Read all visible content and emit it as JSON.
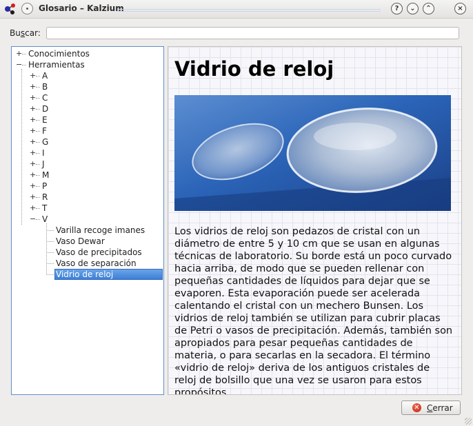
{
  "window": {
    "title": "Glosario – Kalzium",
    "buttons": {
      "help": "?",
      "minimize": "⌄",
      "maximize": "⌃",
      "close": "×"
    }
  },
  "search": {
    "label_pre": "Bu",
    "label_access": "s",
    "label_post": "car:",
    "value": ""
  },
  "tree": {
    "items": [
      {
        "label": "Conocimientos",
        "expander": "+"
      },
      {
        "label": "Herramientas",
        "expander": "−"
      },
      {
        "label": "A",
        "expander": "+"
      },
      {
        "label": "B",
        "expander": "+"
      },
      {
        "label": "C",
        "expander": "+"
      },
      {
        "label": "D",
        "expander": "+"
      },
      {
        "label": "E",
        "expander": "+"
      },
      {
        "label": "F",
        "expander": "+"
      },
      {
        "label": "G",
        "expander": "+"
      },
      {
        "label": "I",
        "expander": "+"
      },
      {
        "label": "J",
        "expander": "+"
      },
      {
        "label": "M",
        "expander": "+"
      },
      {
        "label": "P",
        "expander": "+"
      },
      {
        "label": "R",
        "expander": "+"
      },
      {
        "label": "T",
        "expander": "+"
      },
      {
        "label": "V",
        "expander": "−"
      },
      {
        "label": "Varilla recoge imanes",
        "expander": ""
      },
      {
        "label": "Vaso Dewar",
        "expander": ""
      },
      {
        "label": "Vaso de precipitados",
        "expander": ""
      },
      {
        "label": "Vaso de separación",
        "expander": ""
      },
      {
        "label": "Vidrio de reloj",
        "expander": ""
      }
    ]
  },
  "content": {
    "title": "Vidrio de reloj",
    "body": "Los vidrios de reloj son pedazos de cristal con un diámetro de entre 5 y 10 cm que se usan en algunas técnicas de laboratorio. Su borde está un poco curvado hacia arriba, de modo que se pueden rellenar con pequeñas cantidades de líquidos para dejar que se evaporen. Esta evaporación puede ser acelerada calentando el cristal con un mechero Bunsen. Los vidrios de reloj también se utilizan para cubrir placas de Petri o vasos de precipitación. Además, también son apropiados para pesar pequeñas cantidades de materia, o para secarlas en la secadora. El término «vidrio de reloj» deriva de los antiguos cristales de reloj de bolsillo que una vez se usaron para estos propósitos."
  },
  "footer": {
    "close_pre": "",
    "close_access": "C",
    "close_post": "errar"
  },
  "colors": {
    "selection": "#3d7fd6",
    "tree_border": "#5f8ec7",
    "close_icon": "#c41f0e"
  },
  "icons": [
    "kalzium-app-icon",
    "pin-icon",
    "help-icon",
    "minimize-icon",
    "maximize-icon",
    "close-window-icon",
    "cancel-icon",
    "resize-grip-icon"
  ]
}
